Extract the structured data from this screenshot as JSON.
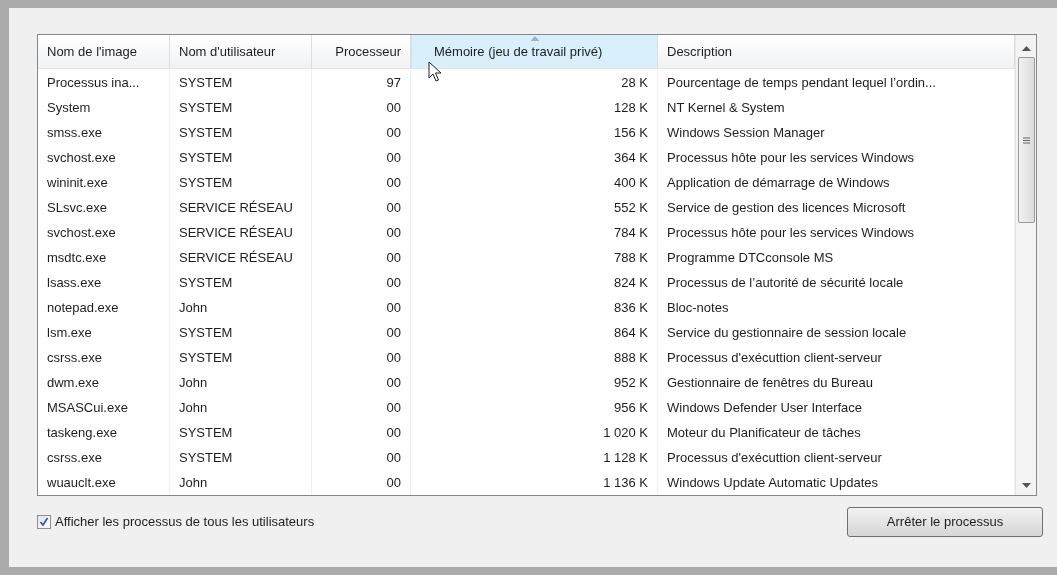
{
  "table": {
    "columns": [
      {
        "label": "Nom de l'image",
        "sorted": false
      },
      {
        "label": "Nom d'utilisateur",
        "sorted": false
      },
      {
        "label": "Processeur",
        "sorted": false
      },
      {
        "label": "Mémoire (jeu de travail privé)",
        "sorted": true
      },
      {
        "label": "Description",
        "sorted": false
      }
    ],
    "rows": [
      [
        "Processus ina...",
        "SYSTEM",
        "97",
        "28 K",
        "Pourcentage de temps pendant lequel l’ordin..."
      ],
      [
        "System",
        "SYSTEM",
        "00",
        "128 K",
        "NT Kernel & System"
      ],
      [
        "smss.exe",
        "SYSTEM",
        "00",
        "156 K",
        "Windows Session Manager"
      ],
      [
        "svchost.exe",
        "SYSTEM",
        "00",
        "364 K",
        "Processus hôte pour les services Windows"
      ],
      [
        "wininit.exe",
        "SYSTEM",
        "00",
        "400 K",
        "Application de démarrage de Windows"
      ],
      [
        "SLsvc.exe",
        "SERVICE RÉSEAU",
        "00",
        "552 K",
        "Service de gestion des licences Microsoft"
      ],
      [
        "svchost.exe",
        "SERVICE RÉSEAU",
        "00",
        "784 K",
        "Processus hôte pour les services Windows"
      ],
      [
        "msdtc.exe",
        "SERVICE RÉSEAU",
        "00",
        "788 K",
        "Programme DTCconsole MS"
      ],
      [
        "lsass.exe",
        "SYSTEM",
        "00",
        "824 K",
        "Processus de l’autorité de sécurité locale"
      ],
      [
        "notepad.exe",
        "John",
        "00",
        "836 K",
        "Bloc-notes"
      ],
      [
        "lsm.exe",
        "SYSTEM",
        "00",
        "864 K",
        "Service du gestionnaire de session locale"
      ],
      [
        "csrss.exe",
        "SYSTEM",
        "00",
        "888 K",
        "Processus d'exécuttion client-serveur"
      ],
      [
        "dwm.exe",
        "John",
        "00",
        "952 K",
        "Gestionnaire de fenêtres du Bureau"
      ],
      [
        "MSASCui.exe",
        "John",
        "00",
        "956 K",
        "Windows Defender User Interface"
      ],
      [
        "taskeng.exe",
        "SYSTEM",
        "00",
        "1 020 K",
        "Moteur du Planificateur de tâches"
      ],
      [
        "csrss.exe",
        "SYSTEM",
        "00",
        "1 128 K",
        "Processus d'exécuttion client-serveur"
      ],
      [
        "wuauclt.exe",
        "John",
        "00",
        "1 136 K",
        "Windows Update Automatic Updates"
      ]
    ]
  },
  "show_all_users": {
    "label": "Afficher les processus de tous les utilisateurs",
    "checked": true
  },
  "end_process_button": "Arrêter le processus"
}
